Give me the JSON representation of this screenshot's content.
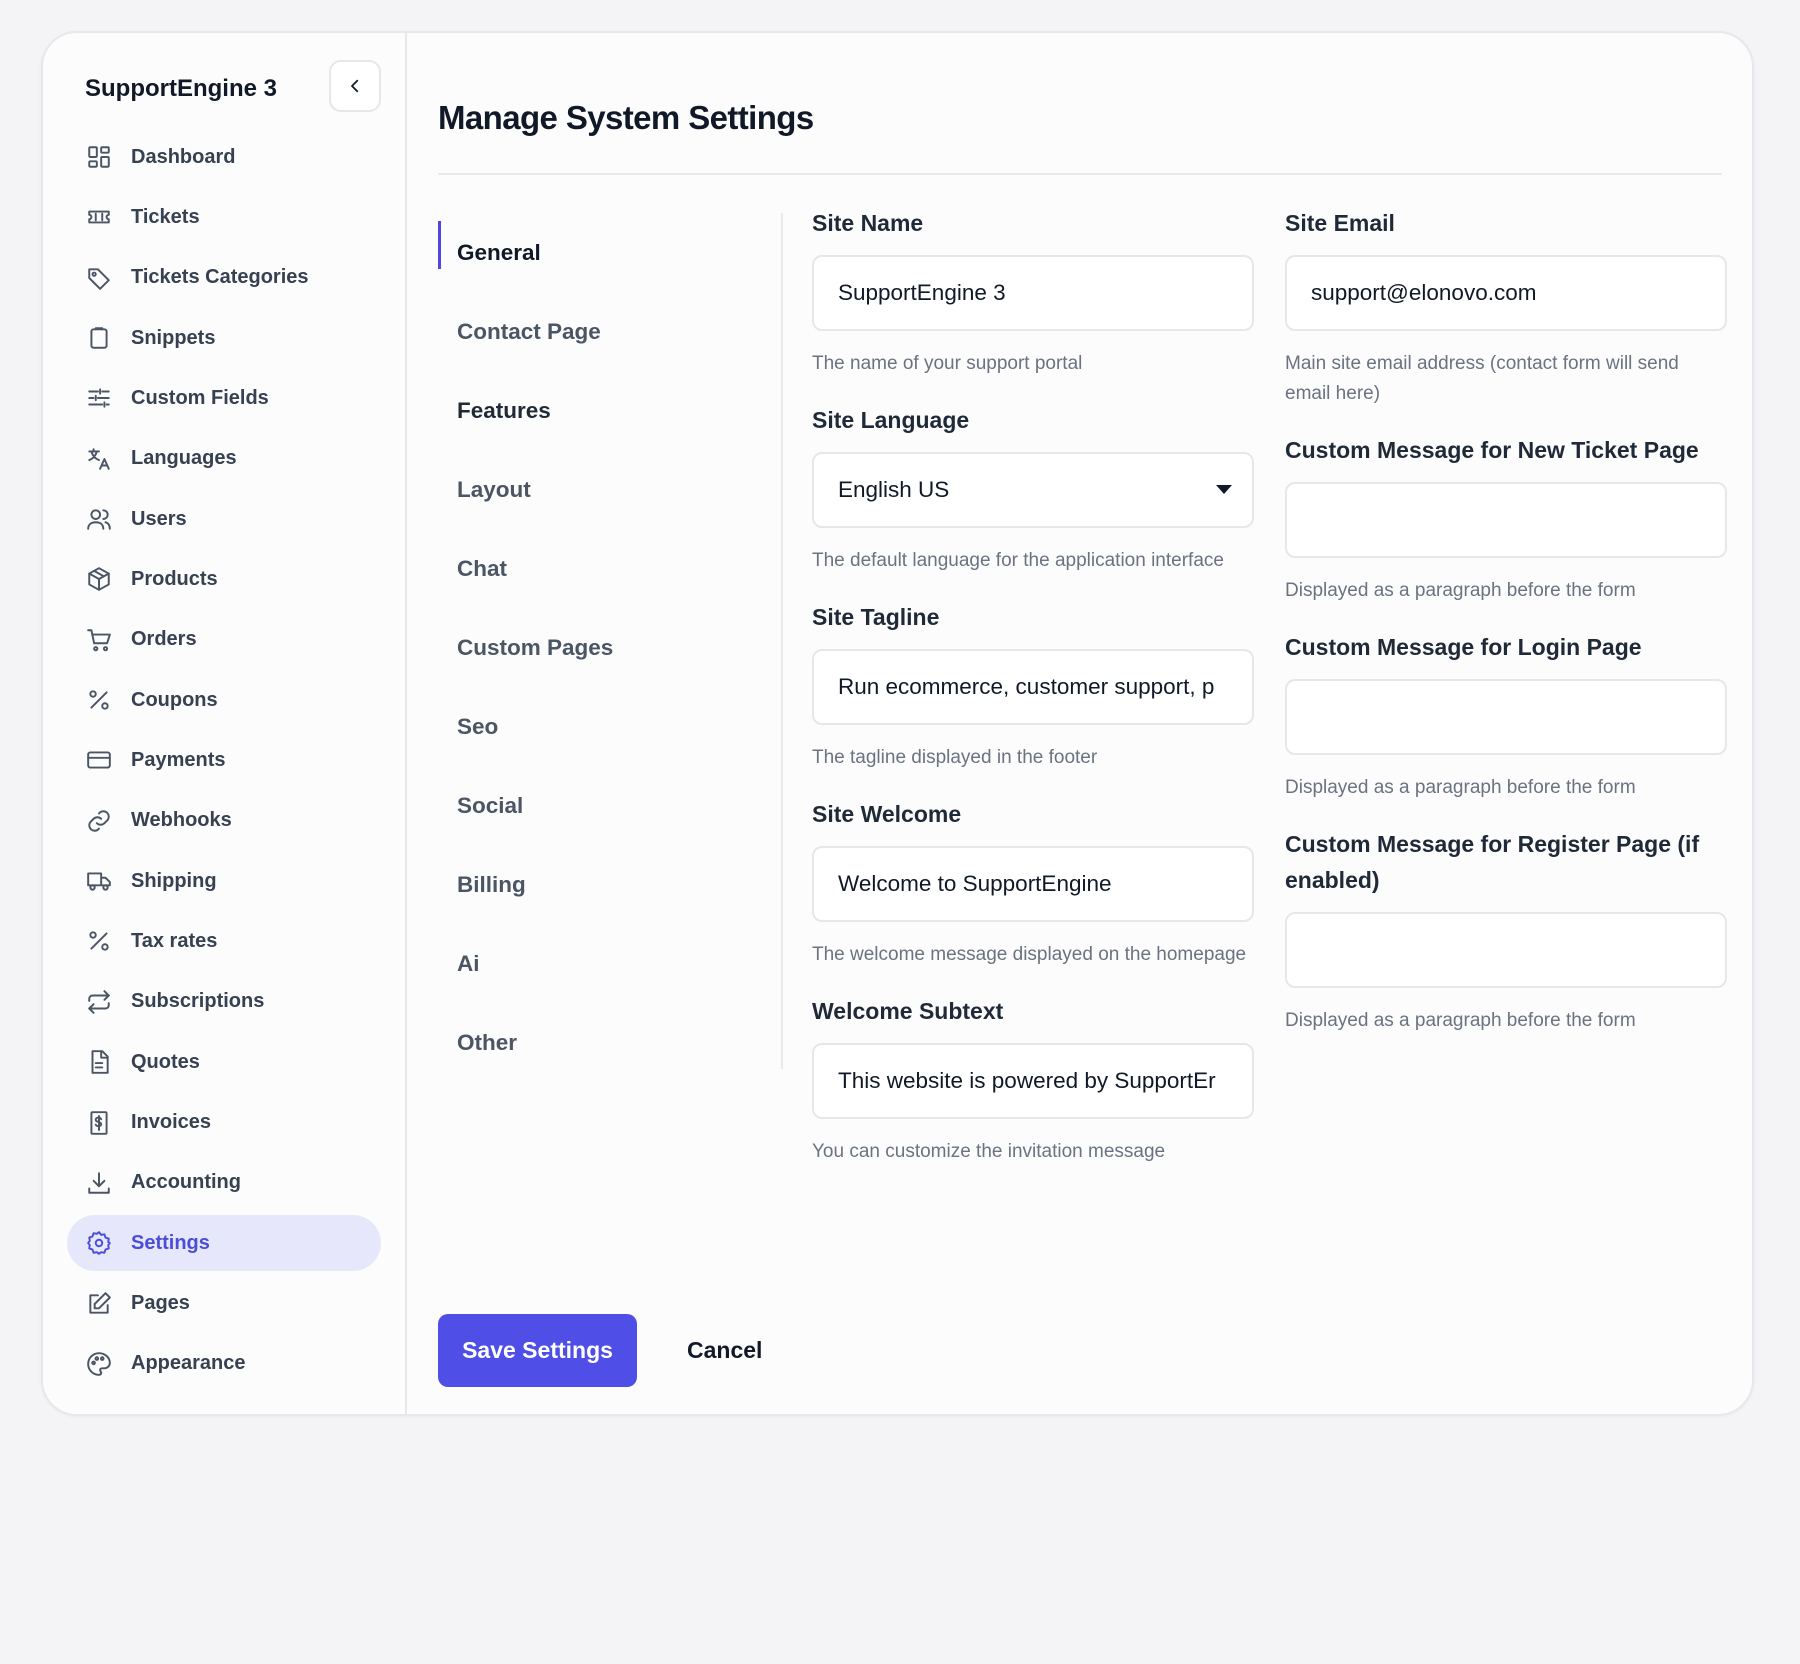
{
  "app": {
    "brand": "SupportEngine 3"
  },
  "sidebar": {
    "items": [
      {
        "label": "Dashboard"
      },
      {
        "label": "Tickets"
      },
      {
        "label": "Tickets Categories"
      },
      {
        "label": "Snippets"
      },
      {
        "label": "Custom Fields"
      },
      {
        "label": "Languages"
      },
      {
        "label": "Users"
      },
      {
        "label": "Products"
      },
      {
        "label": "Orders"
      },
      {
        "label": "Coupons"
      },
      {
        "label": "Payments"
      },
      {
        "label": "Webhooks"
      },
      {
        "label": "Shipping"
      },
      {
        "label": "Tax rates"
      },
      {
        "label": "Subscriptions"
      },
      {
        "label": "Quotes"
      },
      {
        "label": "Invoices"
      },
      {
        "label": "Accounting"
      },
      {
        "label": "Settings",
        "active": true
      },
      {
        "label": "Pages"
      },
      {
        "label": "Appearance"
      }
    ]
  },
  "main": {
    "title": "Manage System Settings",
    "tabs": [
      {
        "label": "General",
        "active": true
      },
      {
        "label": "Contact Page"
      },
      {
        "label": "Features"
      },
      {
        "label": "Layout"
      },
      {
        "label": "Chat"
      },
      {
        "label": "Custom Pages"
      },
      {
        "label": "Seo"
      },
      {
        "label": "Social"
      },
      {
        "label": "Billing"
      },
      {
        "label": "Ai"
      },
      {
        "label": "Other"
      }
    ],
    "fields": {
      "site_name": {
        "label": "Site Name",
        "value": "SupportEngine 3",
        "help": "The name of your support portal"
      },
      "site_language": {
        "label": "Site Language",
        "value": "English US",
        "help": "The default language for the application interface"
      },
      "site_tagline": {
        "label": "Site Tagline",
        "value": "Run ecommerce, customer support, p",
        "help": "The tagline displayed in the footer"
      },
      "site_welcome": {
        "label": "Site Welcome",
        "value": "Welcome to SupportEngine",
        "help": "The welcome message displayed on the homepage"
      },
      "welcome_subtext": {
        "label": "Welcome Subtext",
        "value": "This website is powered by SupportEr",
        "help": "You can customize the invitation message"
      },
      "site_email": {
        "label": "Site Email",
        "value": "support@elonovo.com",
        "help": "Main site email address (contact form will send email here)"
      },
      "msg_new_ticket": {
        "label": "Custom Message for New Ticket Page",
        "value": "",
        "help": "Displayed as a paragraph before the form"
      },
      "msg_login": {
        "label": "Custom Message for Login Page",
        "value": "",
        "help": "Displayed as a paragraph before the form"
      },
      "msg_register": {
        "label": "Custom Message for Register Page (if enabled)",
        "value": "",
        "help": "Displayed as a paragraph before the form"
      }
    },
    "buttons": {
      "save": "Save Settings",
      "cancel": "Cancel"
    }
  },
  "colors": {
    "accent": "#4f4fe8",
    "active_bg": "#e6e7fb",
    "active_text": "#4a4fd6"
  }
}
